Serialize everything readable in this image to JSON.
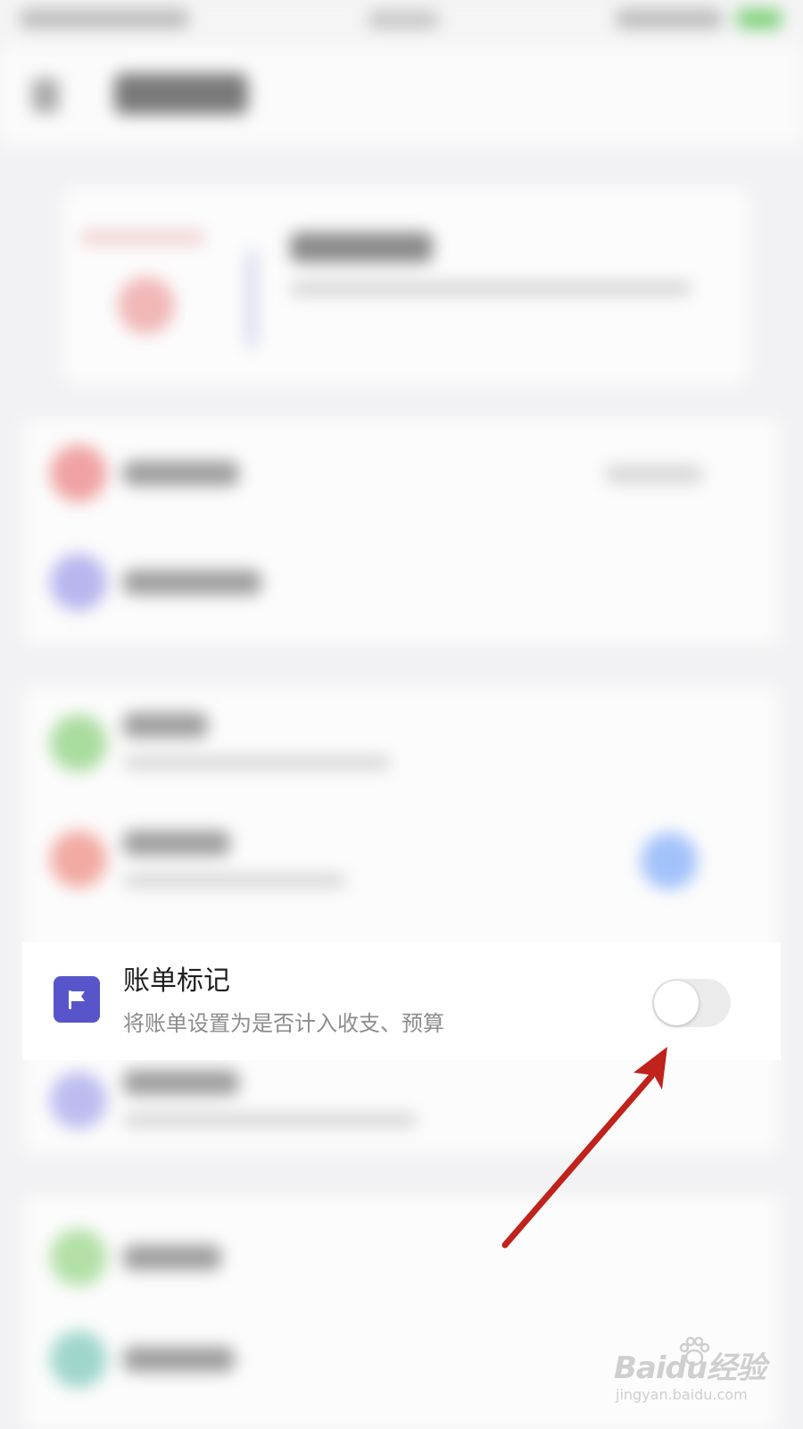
{
  "bill_mark_row": {
    "title": "账单标记",
    "subtitle": "将账单设置为是否计入收支、预算",
    "icon": "flag-icon",
    "icon_color": "#5755c9",
    "toggle_on": false
  },
  "annotation": {
    "arrow_color": "#c0221c"
  },
  "watermark": {
    "logo": "Baidu经验",
    "url": "jingyan.baidu.com"
  }
}
